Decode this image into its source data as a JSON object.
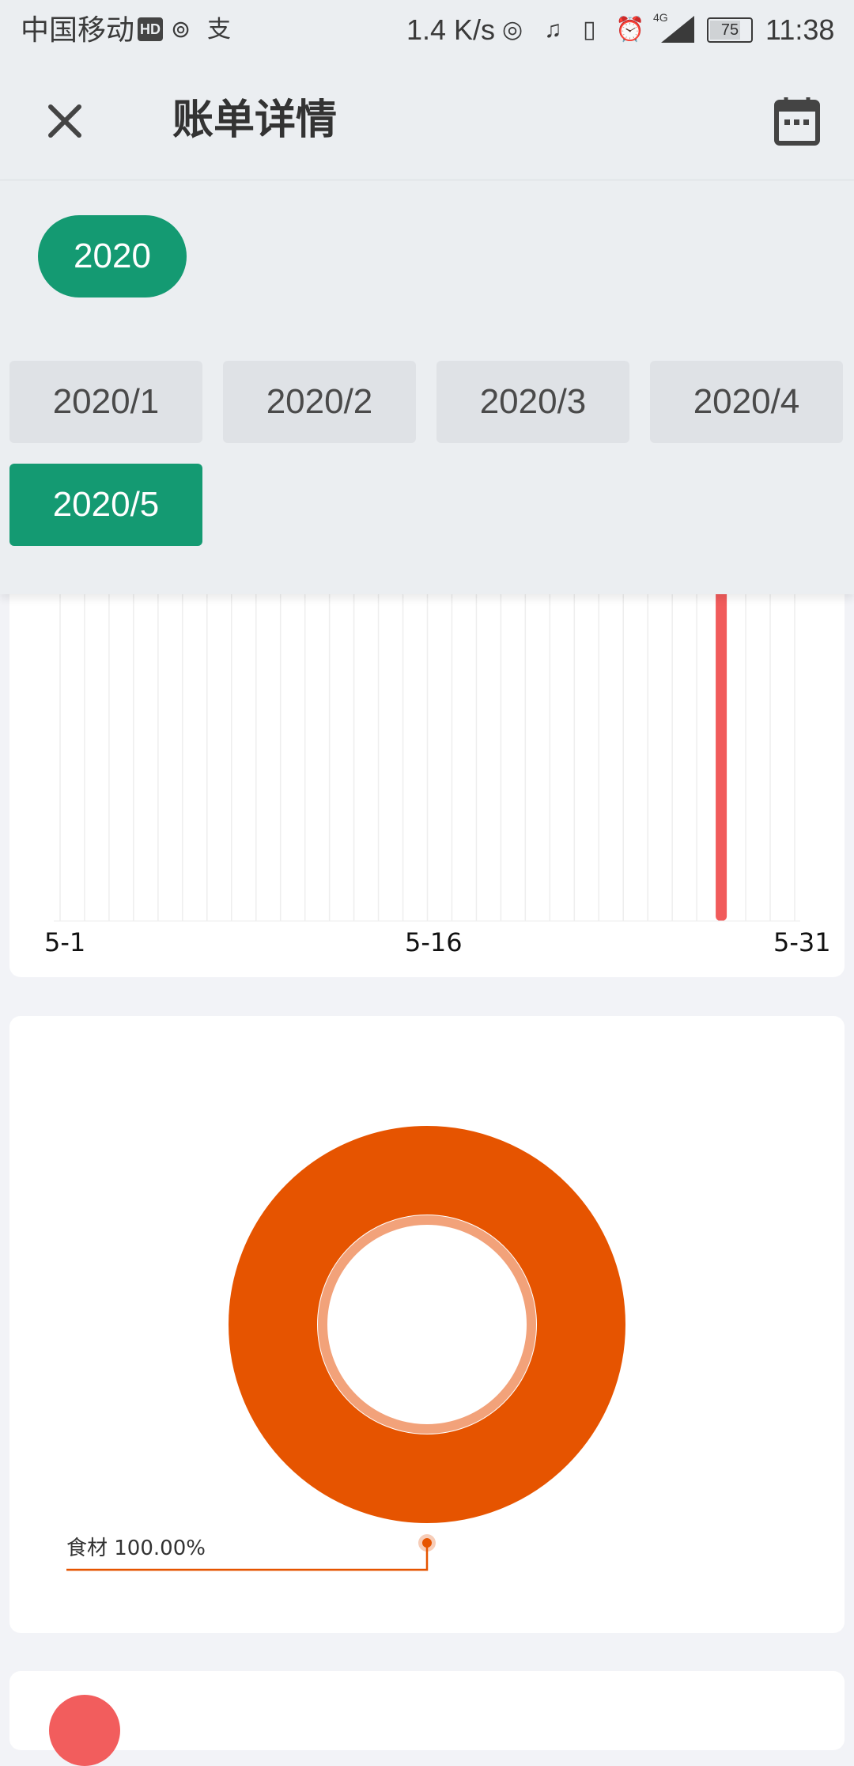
{
  "status_bar": {
    "carrier": "中国移动",
    "hd": "HD",
    "network_speed": "1.4 K/s",
    "network_type": "4G",
    "battery": "75",
    "time": "11:38"
  },
  "header": {
    "title": "账单详情",
    "close_icon": "close-icon",
    "calendar_icon": "calendar-icon"
  },
  "filters": {
    "years": [
      "2020"
    ],
    "selected_year": "2020",
    "months": [
      "2020/1",
      "2020/2",
      "2020/3",
      "2020/4",
      "2020/5"
    ],
    "selected_month": "2020/5"
  },
  "colors": {
    "accent": "#149a72",
    "bar": "#f15b5b",
    "donut": "#e65400",
    "donut_inner_ring": "#f2a27a",
    "list_avatar": "#f25d5d"
  },
  "chart_data": [
    {
      "type": "bar",
      "x_ticks": [
        "5-1",
        "5-16",
        "5-31"
      ],
      "days": 31,
      "bar_day": 28,
      "bar_value_ratio": 1.0,
      "grid": true
    },
    {
      "type": "pie",
      "labels": [
        "食材"
      ],
      "values": [
        100.0
      ],
      "label_texts": [
        "食材 100.00%"
      ]
    }
  ]
}
